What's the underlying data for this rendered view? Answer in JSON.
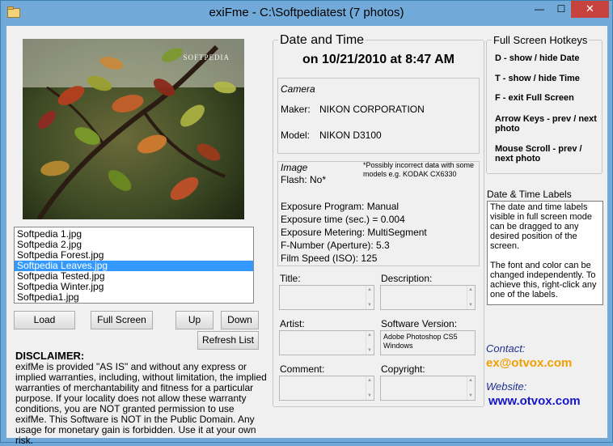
{
  "window": {
    "title": "exiFme - C:\\Softpediatest   (7 photos)",
    "minimize_glyph": "—",
    "maximize_glyph": "☐",
    "close_glyph": "✕"
  },
  "photo": {
    "watermark": "SOFTPEDIA"
  },
  "file_list": [
    {
      "label": "Softpedia 1.jpg",
      "selected": false
    },
    {
      "label": "Softpedia 2.jpg",
      "selected": false
    },
    {
      "label": "Softpedia Forest.jpg",
      "selected": false
    },
    {
      "label": "Softpedia Leaves.jpg",
      "selected": true
    },
    {
      "label": "Softpedia Tested.jpg",
      "selected": false
    },
    {
      "label": "Softpedia Winter.jpg",
      "selected": false
    },
    {
      "label": "Softpedia1.jpg",
      "selected": false
    }
  ],
  "buttons": {
    "load": "Load",
    "full_screen": "Full Screen",
    "up": "Up",
    "down": "Down",
    "refresh": "Refresh List"
  },
  "disclaimer": {
    "title": "DISCLAIMER:",
    "body": "exifMe is provided \"AS IS\" and without any express or implied warranties, including, without limitation, the implied warranties of merchantability and fitness for a particular purpose. If your locality does not allow these warranty conditions, you are NOT granted permission to use exifMe. This Software is NOT in the Public Domain. Any usage for monetary gain is forbidden. Use it at your own risk."
  },
  "date_time": {
    "caption": "Date and Time",
    "value": "on 10/21/2010 at 8:47 AM"
  },
  "camera": {
    "heading": "Camera",
    "maker_label": "Maker:",
    "maker_value": "NIKON CORPORATION",
    "model_label": "Model:",
    "model_value": "NIKON D3100"
  },
  "image": {
    "heading": "Image",
    "flash": "Flash: No*",
    "note": "*Possibly incorrect data with some models e.g. KODAK CX6330",
    "exposure_program": "Exposure Program: Manual",
    "exposure_time": "Exposure time (sec.) = 0.004",
    "exposure_metering": "Exposure Metering: MultiSegment",
    "f_number": "F-Number (Aperture): 5.3",
    "film_speed": "Film Speed (ISO): 125"
  },
  "fields": {
    "title_label": "Title:",
    "description_label": "Description:",
    "artist_label": "Artist:",
    "software_label": "Software Version:",
    "software_value": "Adobe Photoshop CS5 Windows",
    "comment_label": "Comment:",
    "copyright_label": "Copyright:",
    "scroll_up_glyph": "▲",
    "scroll_down_glyph": "▼"
  },
  "hotkeys": {
    "caption": "Full Screen Hotkeys",
    "items": [
      "D - show / hide Date",
      "T - show / hide Time",
      "F - exit Full Screen",
      "Arrow Keys - prev / next photo",
      "Mouse Scroll - prev / next photo"
    ]
  },
  "labels_info": {
    "title": "Date & Time Labels",
    "para1": "The date and time labels visible in full screen mode can be dragged to any desired position of the screen.",
    "para2": "The font and color can be changed independently. To achieve this, right-click any one of the labels."
  },
  "contact": {
    "contact_label": "Contact:",
    "email": "ex@otvox.com",
    "website_label": "Website:",
    "website": "www.otvox.com"
  },
  "colors": {
    "accent_orange": "#f0a000",
    "link_blue": "#1515c8",
    "selection": "#3399ff",
    "titlebar": "#71aad8",
    "close_red": "#c7433d"
  }
}
